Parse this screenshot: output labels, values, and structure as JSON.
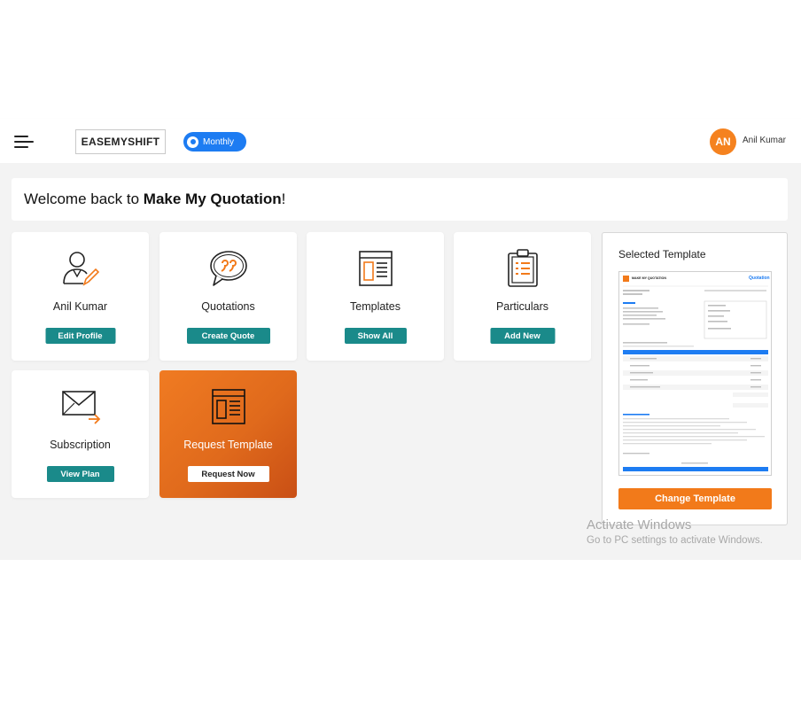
{
  "header": {
    "menu_icon": "hamburger-menu-icon",
    "company": "EASEMYSHIFT",
    "plan": "Monthly",
    "user_initials": "AN",
    "user_name": "Anil Kumar"
  },
  "welcome": {
    "prefix": "Welcome back to ",
    "app_name": "Make My Quotation",
    "suffix": "!"
  },
  "cards": [
    {
      "icon": "user-edit-icon",
      "title": "Anil Kumar",
      "button": "Edit Profile"
    },
    {
      "icon": "chat-quote-icon",
      "title": "Quotations",
      "button": "Create Quote"
    },
    {
      "icon": "template-layout-icon",
      "title": "Templates",
      "button": "Show All"
    },
    {
      "icon": "clipboard-list-icon",
      "title": "Particulars",
      "button": "Add New"
    },
    {
      "icon": "mail-send-icon",
      "title": "Subscription",
      "button": "View Plan"
    },
    {
      "icon": "template-layout-icon",
      "title": "Request Template",
      "button": "Request Now"
    }
  ],
  "selected_template": {
    "title": "Selected Template",
    "preview_heading": "Quotation",
    "preview_brand": "MAKE MY QUOTATION",
    "button": "Change Template"
  },
  "watermark": {
    "line1": "Activate Windows",
    "line2": "Go to PC settings to activate Windows."
  },
  "colors": {
    "accent_teal": "#1a8a8a",
    "accent_orange": "#f27a1a",
    "plan_blue": "#1d7cf2"
  }
}
